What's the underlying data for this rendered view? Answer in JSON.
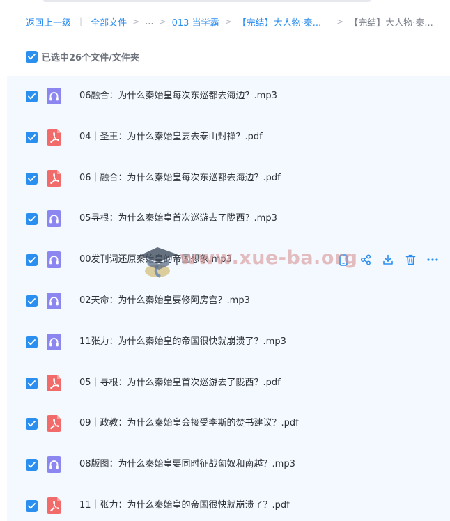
{
  "breadcrumb": {
    "back_label": "返回上一级",
    "all_files_label": "全部文件",
    "ellipsis": "...",
    "folder_1": "013 当学霸",
    "folder_2": "【完结】大人物·秦...",
    "current": "【完结】大人物·秦..."
  },
  "selection": {
    "label": "已选中26个文件/文件夹"
  },
  "files": [
    {
      "name": "06融合：为什么秦始皇每次东巡都去海边？.mp3",
      "type": "audio"
    },
    {
      "name": "04｜圣王：为什么秦始皇要去泰山封禅？.pdf",
      "type": "pdf"
    },
    {
      "name": "06｜融合：为什么秦始皇每次东巡都去海边？.pdf",
      "type": "pdf"
    },
    {
      "name": "05寻根：为什么秦始皇首次巡游去了陇西？.mp3",
      "type": "audio"
    },
    {
      "name": "00发刊词还原秦始皇的帝国想象.mp3",
      "type": "audio"
    },
    {
      "name": "02天命：为什么秦始皇要修阿房宫？.mp3",
      "type": "audio"
    },
    {
      "name": "11张力：为什么秦始皇的帝国很快就崩溃了？.mp3",
      "type": "audio"
    },
    {
      "name": "05｜寻根：为什么秦始皇首次巡游去了陇西？.pdf",
      "type": "pdf"
    },
    {
      "name": "09｜政教：为什么秦始皇会接受李斯的焚书建议？.pdf",
      "type": "pdf"
    },
    {
      "name": "08版图：为什么秦始皇要同时征战匈奴和南越？.mp3",
      "type": "audio"
    },
    {
      "name": "11｜张力：为什么秦始皇的帝国很快就崩溃了？.pdf",
      "type": "pdf"
    }
  ],
  "row_actions_icons": [
    "phone-icon",
    "share-icon",
    "download-icon",
    "delete-icon",
    "more-icon"
  ],
  "watermark": {
    "text": "www.xue-ba.org"
  },
  "colors": {
    "accent": "#2b8ff0",
    "audio_icon": "#8b86f0",
    "pdf_icon": "#f26b6b",
    "list_bg": "#f4f9ff"
  }
}
